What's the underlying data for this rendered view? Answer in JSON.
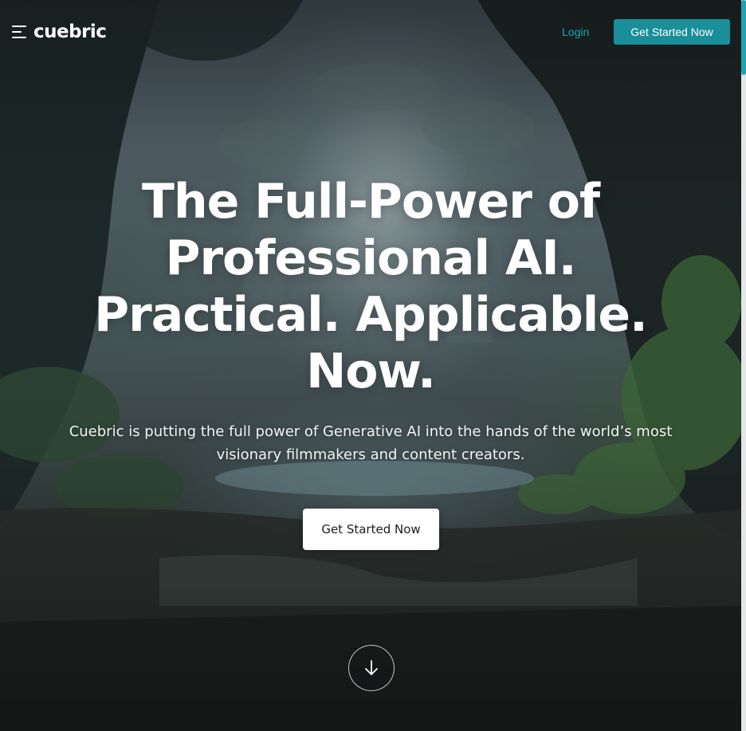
{
  "header": {
    "logo_text": "cuebric",
    "menu_icon": "hamburger-menu-icon",
    "login_label": "Login",
    "cta_label": "Get Started Now"
  },
  "hero": {
    "headline_lines": [
      "The Full-Power of",
      "Professional AI.",
      "Practical. Applicable.",
      "Now."
    ],
    "subtitle_lines": [
      "Cuebric is putting the full power of Generative AI into the hands of the world’s most",
      "visionary filmmakers and content creators."
    ],
    "cta_label": "Get Started Now",
    "scroll_icon": "arrow-down-icon"
  },
  "colors": {
    "accent": "#1aa7b3",
    "header_button": "#1a8f9a",
    "hero_button_bg": "#ffffff",
    "text_light": "#ffffff"
  }
}
